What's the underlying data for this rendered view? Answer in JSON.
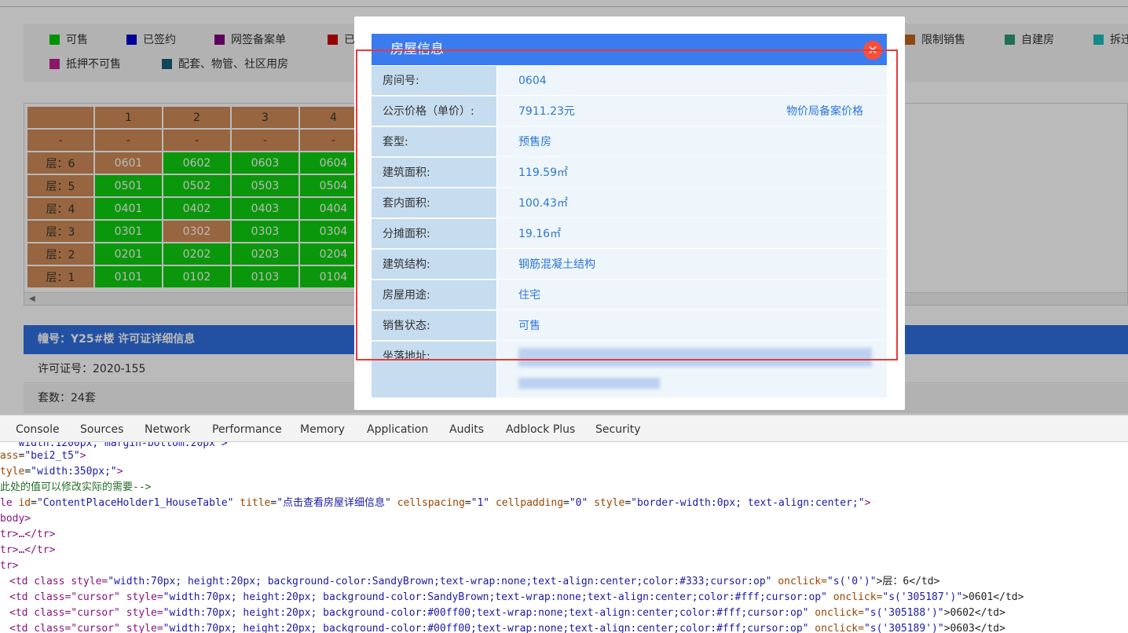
{
  "legend": {
    "row1": [
      {
        "label": "可售",
        "color": "#00cc00"
      },
      {
        "label": "已签约",
        "color": "#0000cc"
      },
      {
        "label": "网签备案单",
        "color": "#800080"
      },
      {
        "label": "已",
        "color": "#cc0000"
      },
      {
        "label": "限制销售",
        "color": "#c0641c"
      },
      {
        "label": "自建房",
        "color": "#2b9a72"
      },
      {
        "label": "拆迁",
        "color": "#1cbcbc"
      }
    ],
    "row2": [
      {
        "label": "抵押不可售",
        "color": "#c0208c"
      },
      {
        "label": "配套、物管、社区用房",
        "color": "#1a6078"
      }
    ]
  },
  "house_table": {
    "header": [
      "",
      "1",
      "2",
      "3",
      "4"
    ],
    "subheader": [
      "-",
      "-",
      "-",
      "-",
      "-"
    ],
    "rows": [
      {
        "floor": "层：6",
        "units": [
          {
            "no": "0601",
            "status": "sold"
          },
          {
            "no": "0602",
            "status": "avail"
          },
          {
            "no": "0603",
            "status": "avail"
          },
          {
            "no": "0604",
            "status": "avail"
          }
        ]
      },
      {
        "floor": "层：5",
        "units": [
          {
            "no": "0501",
            "status": "avail"
          },
          {
            "no": "0502",
            "status": "avail"
          },
          {
            "no": "0503",
            "status": "avail"
          },
          {
            "no": "0504",
            "status": "avail"
          }
        ]
      },
      {
        "floor": "层：4",
        "units": [
          {
            "no": "0401",
            "status": "avail"
          },
          {
            "no": "0402",
            "status": "avail"
          },
          {
            "no": "0403",
            "status": "avail"
          },
          {
            "no": "0404",
            "status": "avail"
          }
        ]
      },
      {
        "floor": "层：3",
        "units": [
          {
            "no": "0301",
            "status": "avail"
          },
          {
            "no": "0302",
            "status": "sold"
          },
          {
            "no": "0303",
            "status": "avail"
          },
          {
            "no": "0304",
            "status": "avail"
          }
        ]
      },
      {
        "floor": "层：2",
        "units": [
          {
            "no": "0201",
            "status": "avail"
          },
          {
            "no": "0202",
            "status": "avail"
          },
          {
            "no": "0203",
            "status": "avail"
          },
          {
            "no": "0204",
            "status": "avail"
          }
        ]
      },
      {
        "floor": "层：1",
        "units": [
          {
            "no": "0101",
            "status": "avail"
          },
          {
            "no": "0102",
            "status": "avail"
          },
          {
            "no": "0103",
            "status": "avail"
          },
          {
            "no": "0104",
            "status": "avail"
          }
        ]
      }
    ]
  },
  "building": {
    "title": "幢号：Y25#楼 许可证详细信息",
    "permit_label": "许可证号：",
    "permit_value": "2020-155",
    "units_label": "套数：",
    "units_value": "24套"
  },
  "modal": {
    "title": "房屋信息",
    "close_icon": "close-icon",
    "rows": [
      {
        "label": "房间号:",
        "value": "0604"
      },
      {
        "label": "公示价格（单价）:",
        "value": "7911.23元",
        "extra": "物价局备案价格"
      },
      {
        "label": "套型:",
        "value": "预售房"
      },
      {
        "label": "建筑面积:",
        "value": "119.59㎡"
      },
      {
        "label": "套内面积:",
        "value": "100.43㎡"
      },
      {
        "label": "分摊面积:",
        "value": "19.16㎡"
      },
      {
        "label": "建筑结构:",
        "value": "钢筋混凝土结构"
      },
      {
        "label": "房屋用途:",
        "value": "住宅"
      },
      {
        "label": "销售状态:",
        "value": "可售"
      },
      {
        "label": "坐落地址:",
        "value": ""
      }
    ]
  },
  "devtools": {
    "tabs": [
      "Console",
      "Sources",
      "Network",
      "Performance",
      "Memory",
      "Application",
      "Audits",
      "Adblock Plus",
      "Security"
    ]
  },
  "code": {
    "l0": "   width:1200px; margin-bottom:20px\">",
    "l1_attr": "ass",
    "l1_val": "\"bei2_t5\"",
    "l2_attr": "tyle",
    "l2_val": "\"width:350px;\"",
    "l3": "此处的值可以修改实际的需要-->",
    "l4_tag": "le",
    "l4_id_attr": "id",
    "l4_id_val": "\"ContentPlaceHolder1_HouseTable\"",
    "l4_title_attr": "title",
    "l4_title_val": "\"点击查看房屋详细信息\"",
    "l4_cs_attr": "cellspacing",
    "l4_cs_val": "\"1\"",
    "l4_cp_attr": "cellpadding",
    "l4_cp_val": "\"0\"",
    "l4_st_attr": "style",
    "l4_st_val": "\"border-width:0px; text-align:center;\"",
    "l5": "body>",
    "l6": "tr>…</tr>",
    "l7": "tr>…</tr>",
    "l8": "tr>",
    "l9_pre": "<td class style=",
    "l9_val": "\"width:70px; height:20px; background-color:SandyBrown;text-wrap:none;text-align:center;color:#333;cursor:op\"",
    "l9_oc": " onclick=",
    "l9_ocv": "\"s('0')\"",
    "l9_text": ">层：6</td>",
    "l10_pre": "<td class=\"cursor\" style=",
    "l10_val": "\"width:70px; height:20px; background-color:SandyBrown;text-wrap:none;text-align:center;color:#fff;cursor:op\"",
    "l10_oc": " onclick=",
    "l10_ocv": "\"s('305187')\"",
    "l10_text": ">0601</td>",
    "l11_pre": "<td class=\"cursor\" style=",
    "l11_val": "\"width:70px; height:20px; background-color:#00ff00;text-wrap:none;text-align:center;color:#fff;cursor:op\"",
    "l11_oc": " onclick=",
    "l11_ocv": "\"s('305188')\"",
    "l11_text": ">0602</td>",
    "l12_pre": "<td class=\"cursor\" style=",
    "l12_val": "\"width:70px; height:20px; background-color:#00ff00;text-wrap:none;text-align:center;color:#fff;cursor:op\"",
    "l12_oc": " onclick=",
    "l12_ocv": "\"s('305189')\"",
    "l12_text": ">0603</td>"
  }
}
